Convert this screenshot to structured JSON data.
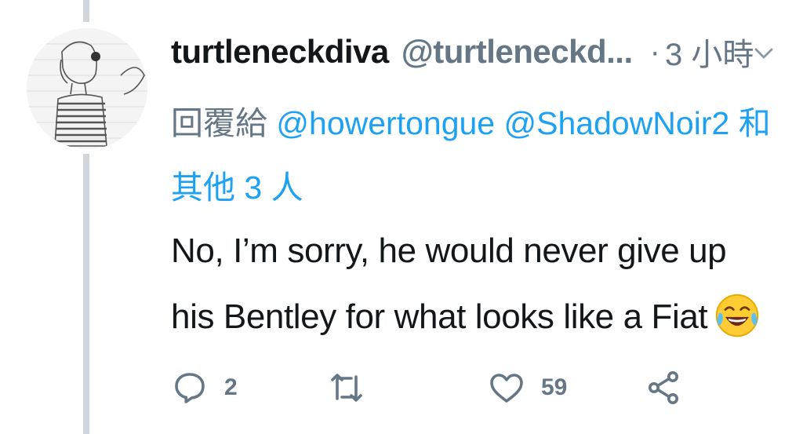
{
  "tweet": {
    "display_name": "turtleneckdiva",
    "handle": "@turtleneckd...",
    "separator": "·",
    "time": "3 小時",
    "reply_prefix": "回覆給",
    "reply_mentions": [
      "@howertongue",
      "@ShadowNoir2"
    ],
    "reply_suffix": "和其他 3 人",
    "text": "No, I’m sorry, he would never give up his Bentley for what looks like a Fiat",
    "emoji": "face-with-tears-of-joy"
  },
  "actions": {
    "reply_count": "2",
    "retweet_count": "",
    "like_count": "59"
  },
  "colors": {
    "link": "#1da1f2",
    "secondary": "#657786",
    "primary": "#14171a",
    "thread_line": "#cfd6dc"
  }
}
